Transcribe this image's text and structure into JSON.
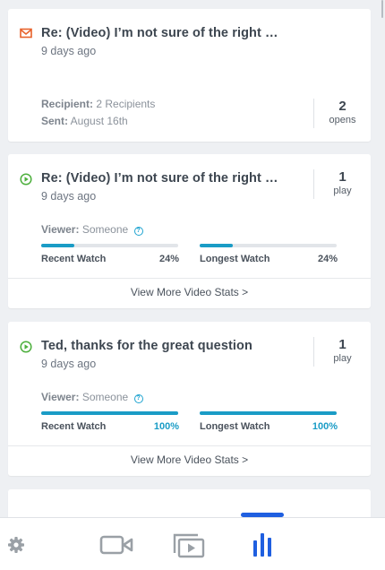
{
  "cards": [
    {
      "icon": "envelope-icon",
      "title": "Re: (Video) I’m not sure of the right …",
      "time": "9 days ago",
      "metric_num": "2",
      "metric_label": "opens",
      "recipient_label": "Recipient:",
      "recipient_value": "2 Recipients",
      "sent_label": "Sent:",
      "sent_value": "August 16th"
    },
    {
      "icon": "play-circle-icon",
      "title": "Re: (Video) I’m not sure of the right …",
      "time": "9 days ago",
      "metric_num": "1",
      "metric_label": "play",
      "viewer_label": "Viewer:",
      "viewer_value": "Someone",
      "recent_label": "Recent Watch",
      "recent_pct": "24%",
      "recent_value": 0.24,
      "longest_label": "Longest Watch",
      "longest_pct": "24%",
      "longest_value": 0.24,
      "link": "View More Video Stats >"
    },
    {
      "icon": "play-circle-icon",
      "title": "Ted, thanks for the great question",
      "time": "9 days ago",
      "metric_num": "1",
      "metric_label": "play",
      "viewer_label": "Viewer:",
      "viewer_value": "Someone",
      "recent_label": "Recent Watch",
      "recent_pct": "100%",
      "recent_value": 1.0,
      "longest_label": "Longest Watch",
      "longest_pct": "100%",
      "longest_value": 1.0,
      "link": "View More Video Stats >"
    }
  ],
  "nav": {
    "items": [
      "gear-icon",
      "video-camera-icon",
      "video-library-icon",
      "stats-icon"
    ],
    "active": "stats-icon"
  },
  "colors": {
    "accent": "#1a9cc6",
    "nav_active": "#1f5fe0",
    "nav_inactive": "#9aa0a6",
    "email": "#e8622b",
    "play": "#4caf3c"
  }
}
